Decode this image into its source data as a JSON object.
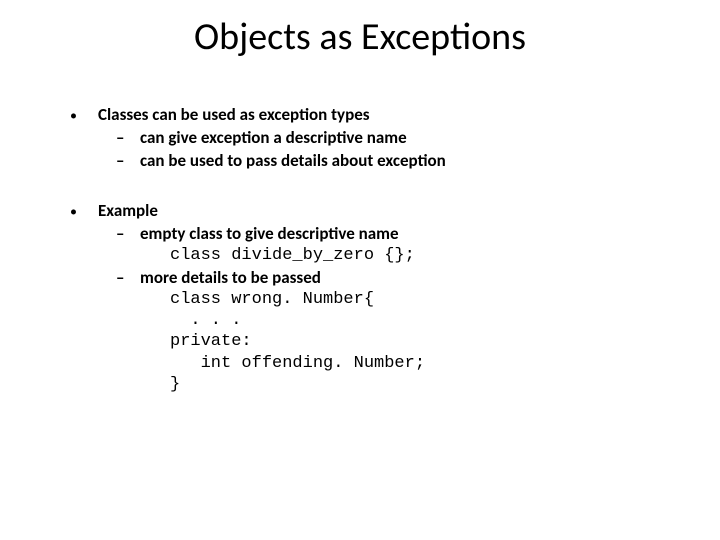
{
  "title": "Objects as Exceptions",
  "bullets": {
    "b1": {
      "head": "Classes can be used as exception types",
      "sub1": "can give exception a descriptive name",
      "sub2": "can be used to pass details about exception"
    },
    "b2": {
      "head": "Example",
      "sub1": "empty class to give descriptive name",
      "code1": "class divide_by_zero {};",
      "sub2": "more details to be passed",
      "code2_l1": "class wrong. Number{",
      "code2_l2": "  . . .",
      "code2_l3": "private:",
      "code2_l4": "   int offending. Number;",
      "code2_l5": "}"
    }
  }
}
